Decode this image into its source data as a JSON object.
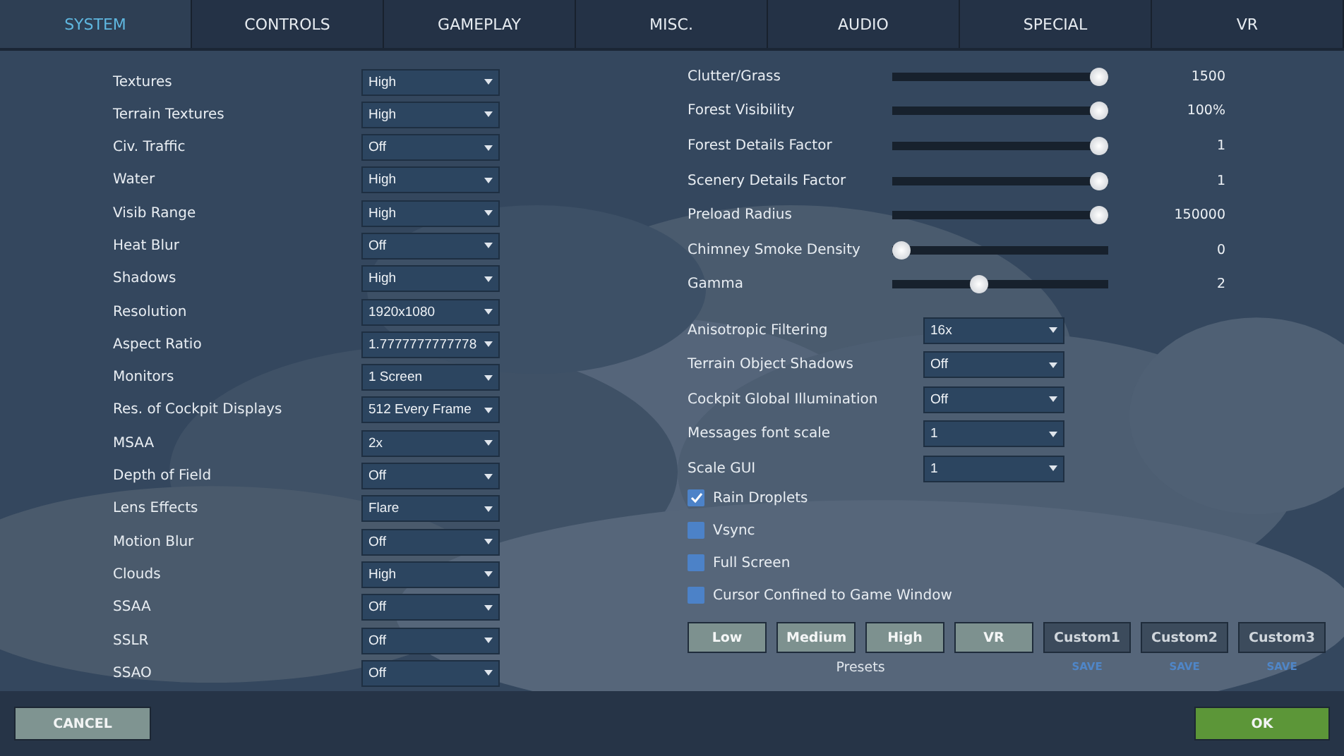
{
  "tabs": [
    {
      "label": "SYSTEM",
      "selected": true
    },
    {
      "label": "CONTROLS",
      "selected": false
    },
    {
      "label": "GAMEPLAY",
      "selected": false
    },
    {
      "label": "MISC.",
      "selected": false
    },
    {
      "label": "AUDIO",
      "selected": false
    },
    {
      "label": "SPECIAL",
      "selected": false
    },
    {
      "label": "VR",
      "selected": false
    }
  ],
  "left_settings": [
    {
      "label": "Textures",
      "value": "High"
    },
    {
      "label": "Terrain Textures",
      "value": "High"
    },
    {
      "label": "Civ. Traffic",
      "value": "Off"
    },
    {
      "label": "Water",
      "value": "High"
    },
    {
      "label": "Visib Range",
      "value": "High"
    },
    {
      "label": "Heat Blur",
      "value": "Off"
    },
    {
      "label": "Shadows",
      "value": "High"
    },
    {
      "label": "Resolution",
      "value": "1920x1080"
    },
    {
      "label": "Aspect Ratio",
      "value": "1.7777777777778"
    },
    {
      "label": "Monitors",
      "value": "1 Screen"
    },
    {
      "label": "Res. of Cockpit Displays",
      "value": "512 Every Frame"
    },
    {
      "label": "MSAA",
      "value": "2x"
    },
    {
      "label": "Depth of Field",
      "value": "Off"
    },
    {
      "label": "Lens Effects",
      "value": "Flare"
    },
    {
      "label": "Motion Blur",
      "value": "Off"
    },
    {
      "label": "Clouds",
      "value": "High"
    },
    {
      "label": "SSAA",
      "value": "Off"
    },
    {
      "label": "SSLR",
      "value": "Off"
    },
    {
      "label": "SSAO",
      "value": "Off"
    }
  ],
  "sliders": [
    {
      "label": "Clutter/Grass",
      "level": 1,
      "reading": "1500"
    },
    {
      "label": "Forest Visibility",
      "level": 1,
      "reading": "100%"
    },
    {
      "label": "Forest Details Factor",
      "level": 1,
      "reading": "1"
    },
    {
      "label": "Scenery Details Factor",
      "level": 1,
      "reading": "1"
    },
    {
      "label": "Preload Radius",
      "level": 1,
      "reading": "150000"
    },
    {
      "label": "Chimney Smoke Density",
      "level": 0,
      "reading": "0"
    },
    {
      "label": "Gamma",
      "level": 0.39,
      "reading": "2"
    }
  ],
  "right_settings": [
    {
      "label": "Anisotropic Filtering",
      "value": "16x"
    },
    {
      "label": "Terrain Object Shadows",
      "value": "Off"
    },
    {
      "label": "Cockpit Global Illumination",
      "value": "Off"
    },
    {
      "label": "Messages font scale",
      "value": "1"
    },
    {
      "label": "Scale GUI",
      "value": "1"
    }
  ],
  "checkboxes": [
    {
      "label": "Rain Droplets",
      "checked": true
    },
    {
      "label": "Vsync",
      "checked": false
    },
    {
      "label": "Full Screen",
      "checked": false
    },
    {
      "label": "Cursor Confined to Game Window",
      "checked": false
    }
  ],
  "presets": {
    "caption": "Presets",
    "buttons": [
      {
        "kind": "preset",
        "label": "Low"
      },
      {
        "kind": "preset",
        "label": "Medium"
      },
      {
        "kind": "preset",
        "label": "High"
      },
      {
        "kind": "preset",
        "label": "VR"
      },
      {
        "kind": "custom",
        "label": "Custom1",
        "save": "SAVE"
      },
      {
        "kind": "custom",
        "label": "Custom2",
        "save": "SAVE"
      },
      {
        "kind": "custom",
        "label": "Custom3",
        "save": "SAVE"
      }
    ]
  },
  "footer": {
    "cancel": "CANCEL",
    "ok": "OK"
  }
}
